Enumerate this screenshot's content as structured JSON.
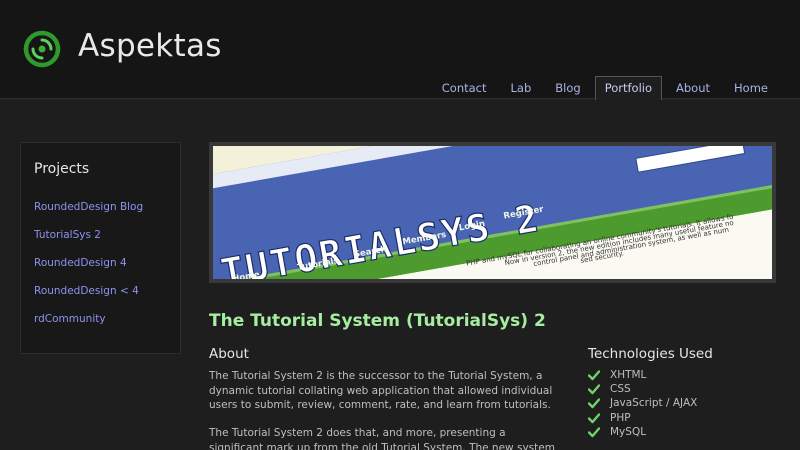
{
  "site": {
    "name": "Aspektas",
    "logo_icon": "swirl-logo-icon",
    "accent_color": "#3fae3a"
  },
  "nav": {
    "items": [
      {
        "label": "Contact"
      },
      {
        "label": "Lab"
      },
      {
        "label": "Blog"
      },
      {
        "label": "Portfolio",
        "active": true
      },
      {
        "label": "About"
      },
      {
        "label": "Home"
      }
    ]
  },
  "sidebar": {
    "title": "Projects",
    "items": [
      {
        "label": "RoundedDesign Blog"
      },
      {
        "label": "TutorialSys 2"
      },
      {
        "label": "RoundedDesign 4"
      },
      {
        "label": "RoundedDesign < 4"
      },
      {
        "label": "rdCommunity"
      }
    ]
  },
  "screenshot": {
    "heading": "TUTORIALSYS 2",
    "menu": [
      "Home",
      "Tutorials",
      "Search",
      "Members",
      "Login",
      "Register"
    ],
    "lines": [
      "PHP and mySQL for collaborating an online community's tutorials. It allows fo",
      "Now in version 2, the new edition includes many useful feature no",
      "control panel and administration system, as well as num",
      "sed security."
    ]
  },
  "project": {
    "title": "The Tutorial System (TutorialSys) 2",
    "about_heading": "About",
    "about_p1": "The Tutorial System 2 is the successor to the Tutorial System, a dynamic tutorial collating web application that allowed individual users to submit, review, comment, rate, and learn from tutorials.",
    "about_p2": "The Tutorial System 2 does that, and more, presenting a significant mark up from the old Tutorial System. The new system",
    "tech_heading": "Technologies Used",
    "technologies": [
      "XHTML",
      "CSS",
      "JavaScript / AJAX",
      "PHP",
      "MySQL"
    ],
    "check_icon": "checkmark-icon",
    "check_color": "#6ed46a"
  }
}
